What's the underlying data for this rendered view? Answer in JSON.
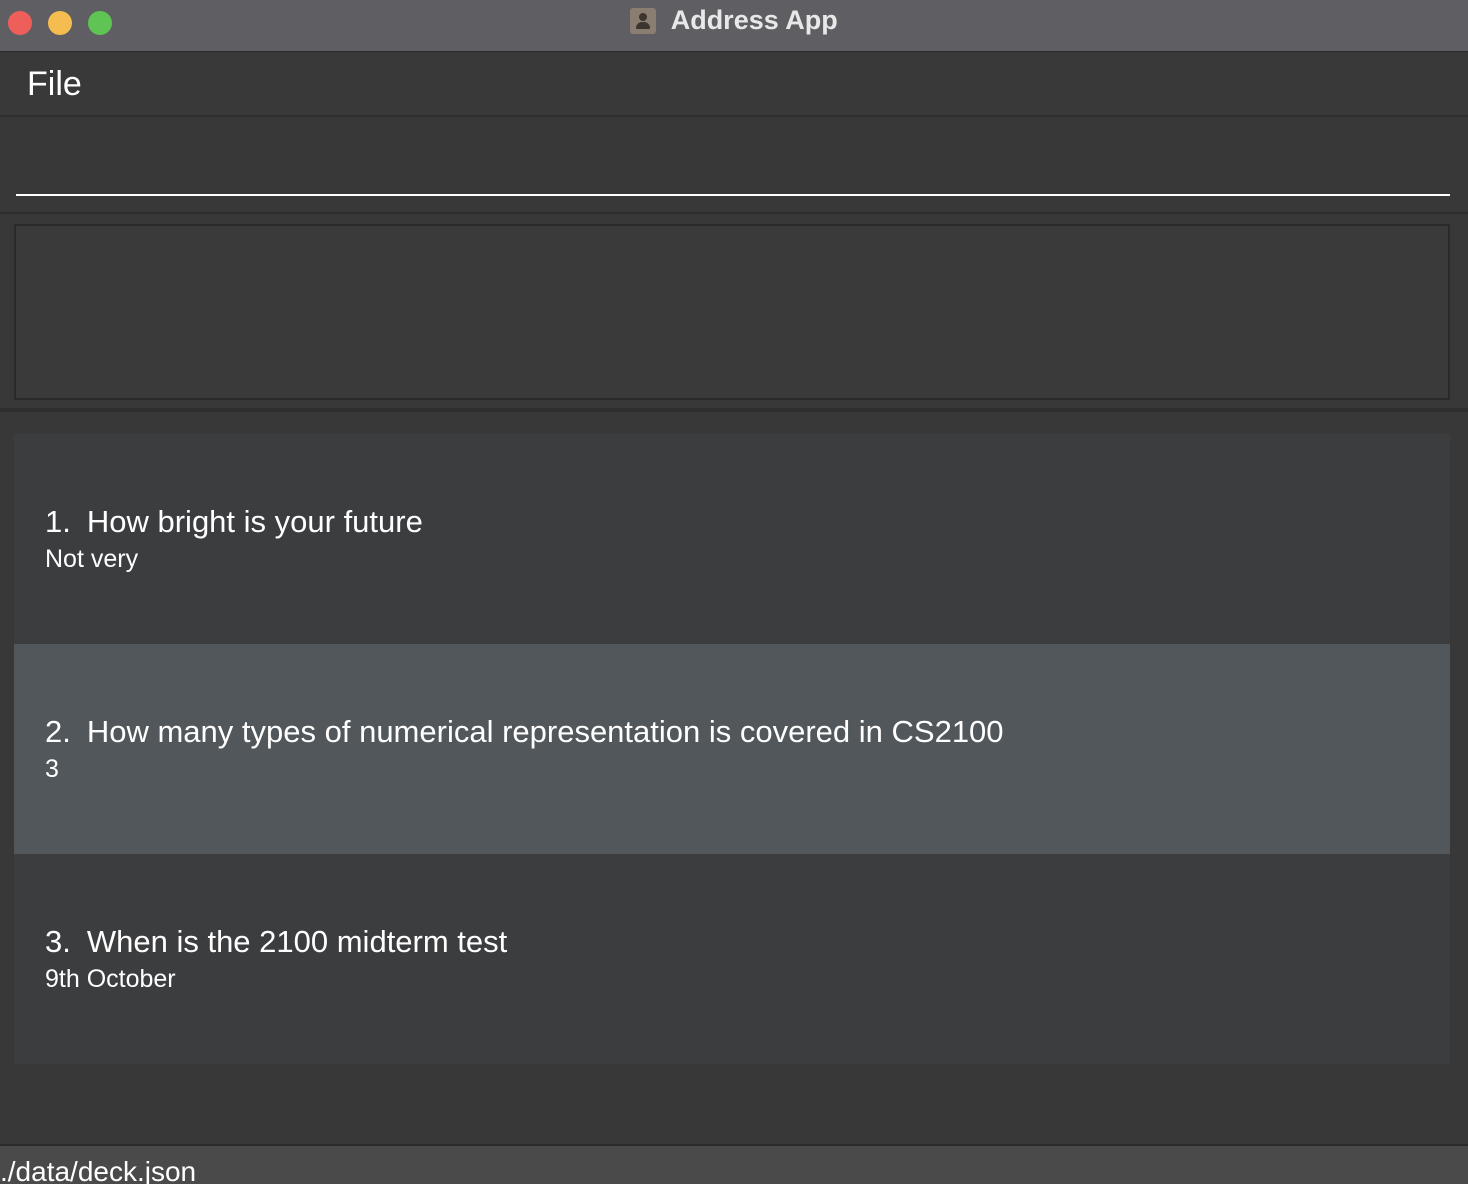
{
  "window": {
    "title": "Address App",
    "app_icon": "address-book-icon"
  },
  "menubar": {
    "file_label": "File"
  },
  "command": {
    "value": "",
    "placeholder": ""
  },
  "result": {
    "text": ""
  },
  "cards": [
    {
      "index": "1.",
      "question": "How bright is your future",
      "answer": "Not very"
    },
    {
      "index": "2.",
      "question": "How many types of numerical representation is covered in CS2100",
      "answer": "3"
    },
    {
      "index": "3.",
      "question": "When is the 2100 midterm test",
      "answer": "9th October"
    }
  ],
  "status": {
    "path": "./data/deck.json"
  },
  "colors": {
    "background": "#383838",
    "titlebar": "#5f5e63",
    "card": "#3c3d3f",
    "card_selected": "#51575b",
    "close": "#ee5f5b",
    "minimize": "#f5bd4f",
    "maximize": "#5fc453"
  }
}
